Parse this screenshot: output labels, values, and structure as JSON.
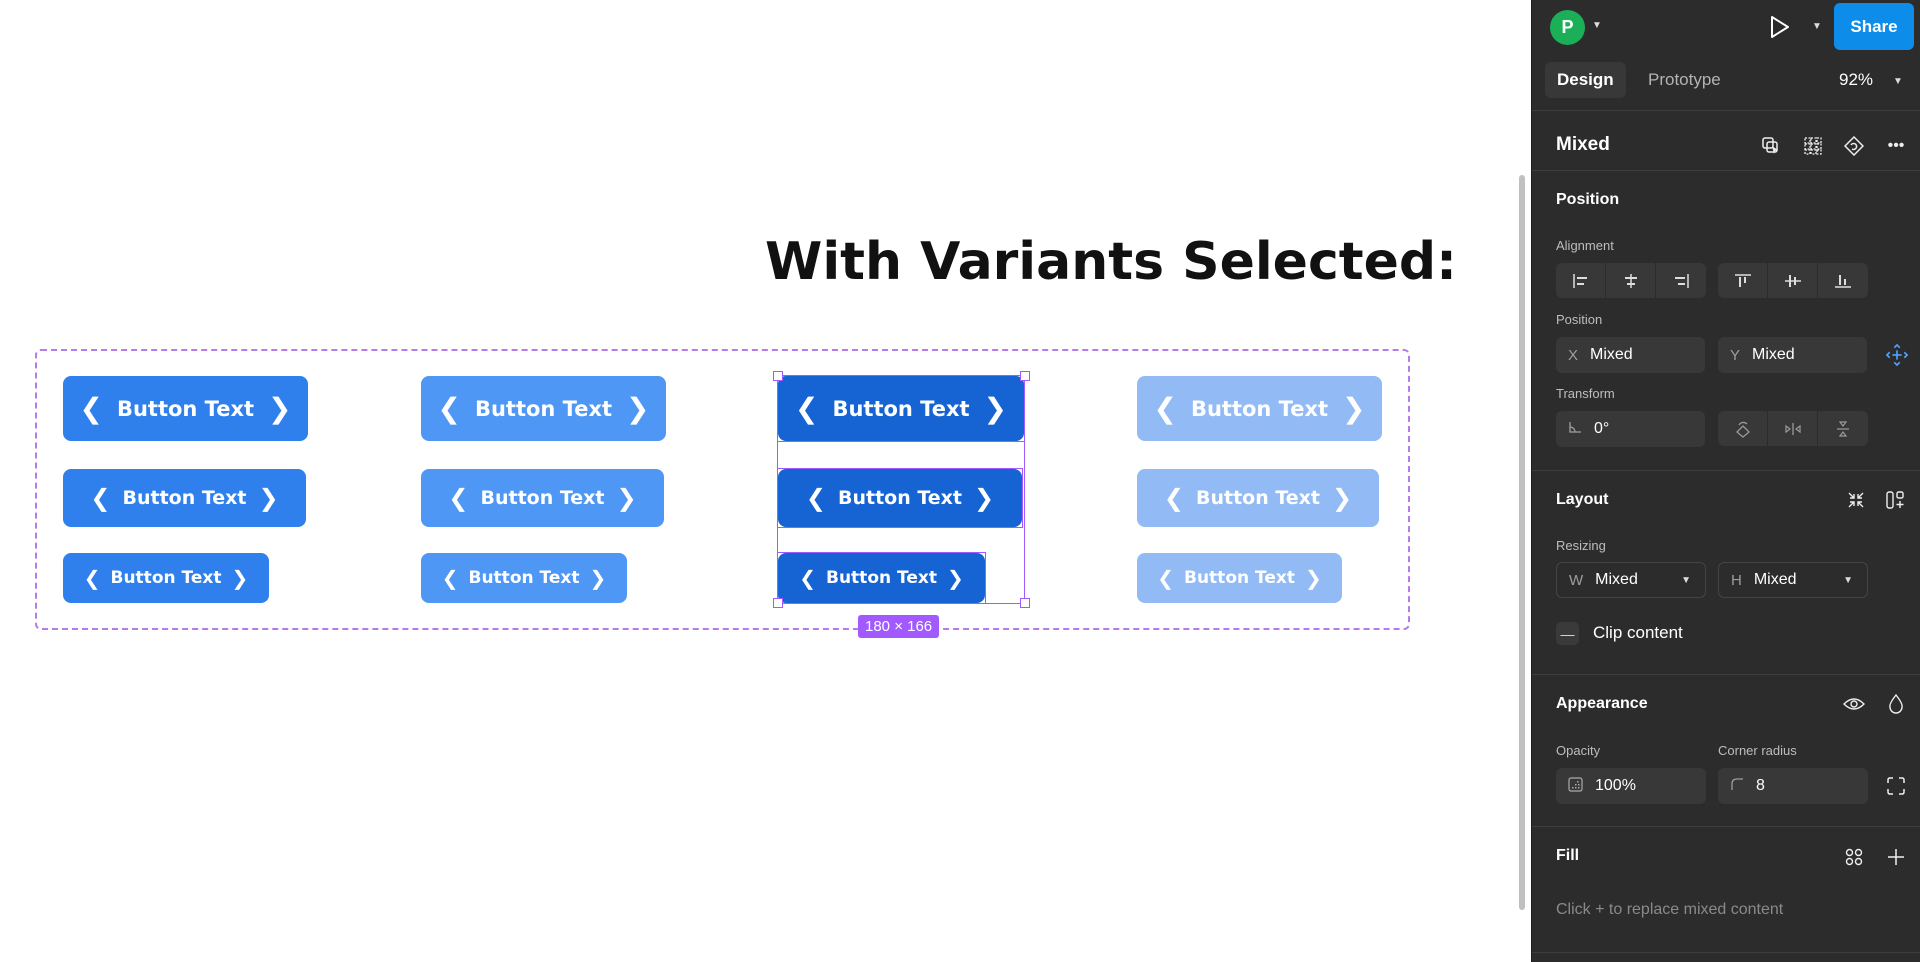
{
  "canvas": {
    "heading": "With Variants Selected:",
    "button_label": "Button Text",
    "chevron_left": "‹",
    "chevron_right": "›",
    "selection_size": "180 × 166",
    "columns": [
      {
        "variant": "default",
        "color": "#2f80ed"
      },
      {
        "variant": "hover",
        "color": "#4f97f4"
      },
      {
        "variant": "pressed",
        "color": "#1664d4",
        "selected": true
      },
      {
        "variant": "disabled",
        "color": "#92bbf5"
      }
    ],
    "rows": [
      "large",
      "medium",
      "small"
    ]
  },
  "header": {
    "avatar_initial": "P",
    "share_label": "Share",
    "zoom_level": "92%",
    "tabs": [
      {
        "label": "Design",
        "active": true
      },
      {
        "label": "Prototype",
        "active": false
      }
    ]
  },
  "selection": {
    "title": "Mixed"
  },
  "position_section": {
    "title": "Position",
    "alignment_label": "Alignment",
    "position_label": "Position",
    "x_prefix": "X",
    "x_value": "Mixed",
    "y_prefix": "Y",
    "y_value": "Mixed",
    "transform_label": "Transform",
    "rotation_value": "0°"
  },
  "layout_section": {
    "title": "Layout",
    "resizing_label": "Resizing",
    "w_prefix": "W",
    "w_value": "Mixed",
    "h_prefix": "H",
    "h_value": "Mixed",
    "clip_content_label": "Clip content"
  },
  "appearance_section": {
    "title": "Appearance",
    "opacity_label": "Opacity",
    "opacity_value": "100%",
    "corner_radius_label": "Corner radius",
    "corner_radius_value": "8"
  },
  "fill_section": {
    "title": "Fill",
    "hint": "Click + to replace mixed content"
  }
}
